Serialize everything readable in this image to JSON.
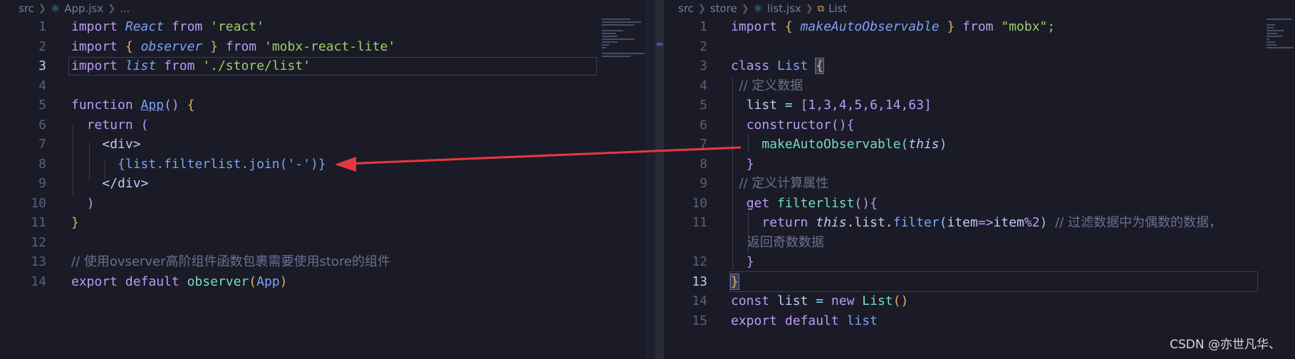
{
  "left": {
    "breadcrumb": [
      "src",
      "App.jsx",
      "..."
    ],
    "lines": [
      {
        "n": "1",
        "html_key": "l1"
      },
      {
        "n": "2"
      },
      {
        "n": "3"
      },
      {
        "n": "4"
      },
      {
        "n": "5"
      },
      {
        "n": "6"
      },
      {
        "n": "7"
      },
      {
        "n": "8"
      },
      {
        "n": "9"
      },
      {
        "n": "10"
      },
      {
        "n": "11"
      },
      {
        "n": "12"
      },
      {
        "n": "13"
      },
      {
        "n": "14"
      }
    ],
    "code": {
      "l1_import": "import",
      "l1_name": "React",
      "l1_from": "from",
      "l1_str": "'react'",
      "l2_import": "import",
      "l2_open": "{",
      "l2_name": "observer",
      "l2_close": "}",
      "l2_from": "from",
      "l2_str": "'mobx-react-lite'",
      "l3_import": "import",
      "l3_name": "list",
      "l3_from": "from",
      "l3_str": "'./store/list'",
      "l5_function": "function",
      "l5_name": "App",
      "l5_paren": "()",
      "l5_brace": "{",
      "l6_return": "return",
      "l6_paren": "(",
      "l7_tag": "<div>",
      "l8_code": "{list.filterlist.join('-')}",
      "l9_tag": "</div>",
      "l10_paren": ")",
      "l11_brace": "}",
      "l13_comment": "// 使用ovserver高阶组件函数包裹需要使用store的组件",
      "l14_export": "export",
      "l14_default": "default",
      "l14_fn": "observer",
      "l14_arg": "App"
    }
  },
  "right": {
    "breadcrumb": [
      "src",
      "store",
      "list.jsx",
      "List"
    ],
    "code": {
      "l1_import": "import",
      "l1_name": "makeAutoObservable",
      "l1_from": "from",
      "l1_str": "\"mobx\";",
      "l3_class": "class",
      "l3_name": "List",
      "l3_brace": "{",
      "l4_comment": "// 定义数据",
      "l5_list": "list",
      "l5_eq": "=",
      "l5_arr": "[1,3,4,5,6,14,63]",
      "l6_ctor": "constructor",
      "l6_rest": "(){",
      "l7_fn": "makeAutoObservable",
      "l7_this": "this",
      "l8_brace": "}",
      "l9_comment": "// 定义计算属性",
      "l10_get": "get",
      "l10_name": "filterlist",
      "l10_rest": "(){",
      "l11_return": "return",
      "l11_this": "this",
      "l11_rest": ".list.",
      "l11_filter": "filter",
      "l11_item1": "item",
      "l11_arrow": "=>",
      "l11_item2": "item",
      "l11_mod": "%2",
      "l11_comment": "// 过滤数据中为偶数的数据，",
      "l11b_comment": "返回奇数数据",
      "l12_brace": "}",
      "l13_brace": "}",
      "l14_const": "const",
      "l14_list": "list",
      "l14_eq": "=",
      "l14_new": "new",
      "l14_cls": "List",
      "l14_paren": "()",
      "l15_export": "export",
      "l15_default": "default",
      "l15_list": "list"
    },
    "line_numbers": [
      "1",
      "2",
      "3",
      "4",
      "5",
      "6",
      "7",
      "8",
      "9",
      "10",
      "11",
      "",
      "12",
      "13",
      "14",
      "15"
    ]
  },
  "left_line_numbers": [
    "1",
    "2",
    "3",
    "4",
    "5",
    "6",
    "7",
    "8",
    "9",
    "10",
    "11",
    "12",
    "13",
    "14"
  ],
  "watermark": "CSDN @亦世凡华、",
  "colors": {
    "background": "#1a1b26",
    "arrow": "#e8383d"
  }
}
